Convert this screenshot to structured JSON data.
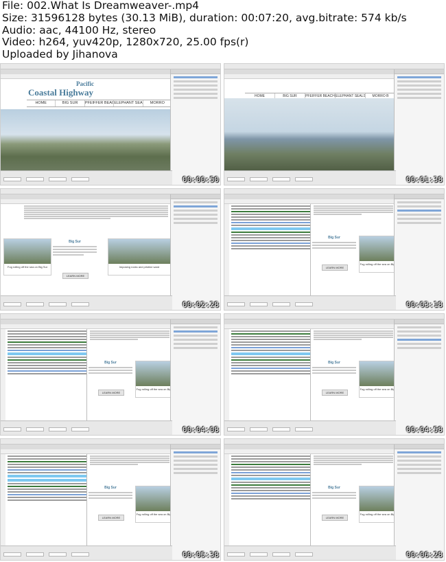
{
  "header": {
    "file_line": "File: 002.What Is Dreamweaver-.mp4",
    "size_line": "Size: 31596128 bytes (30.13 MiB), duration: 00:07:20, avg.bitrate: 574 kb/s",
    "audio_line": "Audio: aac, 44100 Hz, stereo",
    "video_line": "Video: h264, yuv420p, 1280x720, 25.00 fps(r)",
    "uploader_line": "Uploaded by Jihanova"
  },
  "site": {
    "logo_line1": "Pacific",
    "logo_line2": "Coastal Highway",
    "nav": [
      "HOME",
      "BIG SUR",
      "PFEIFFER BEACH",
      "ELEPHANT SEALS",
      "MORRO"
    ],
    "nav_wide": [
      "HOME",
      "BIG SUR",
      "PFEIFFER BEACH",
      "ELEPHANT SEALS",
      "MORRO B"
    ],
    "card_caption_1": "Fog rolling off the sea on Big Sur",
    "card_caption_2": "Imposing rocks and pristine sand",
    "card_caption_3": "Fog rolling off the sea on Big",
    "blurb_title": "Big Sur",
    "button_label": "LEARN MORE"
  },
  "timestamps": [
    "00:00:50",
    "00:01:38",
    "00:02:28",
    "00:03:18",
    "00:04:08",
    "00:04:58",
    "00:05:38",
    "00:06:28"
  ]
}
